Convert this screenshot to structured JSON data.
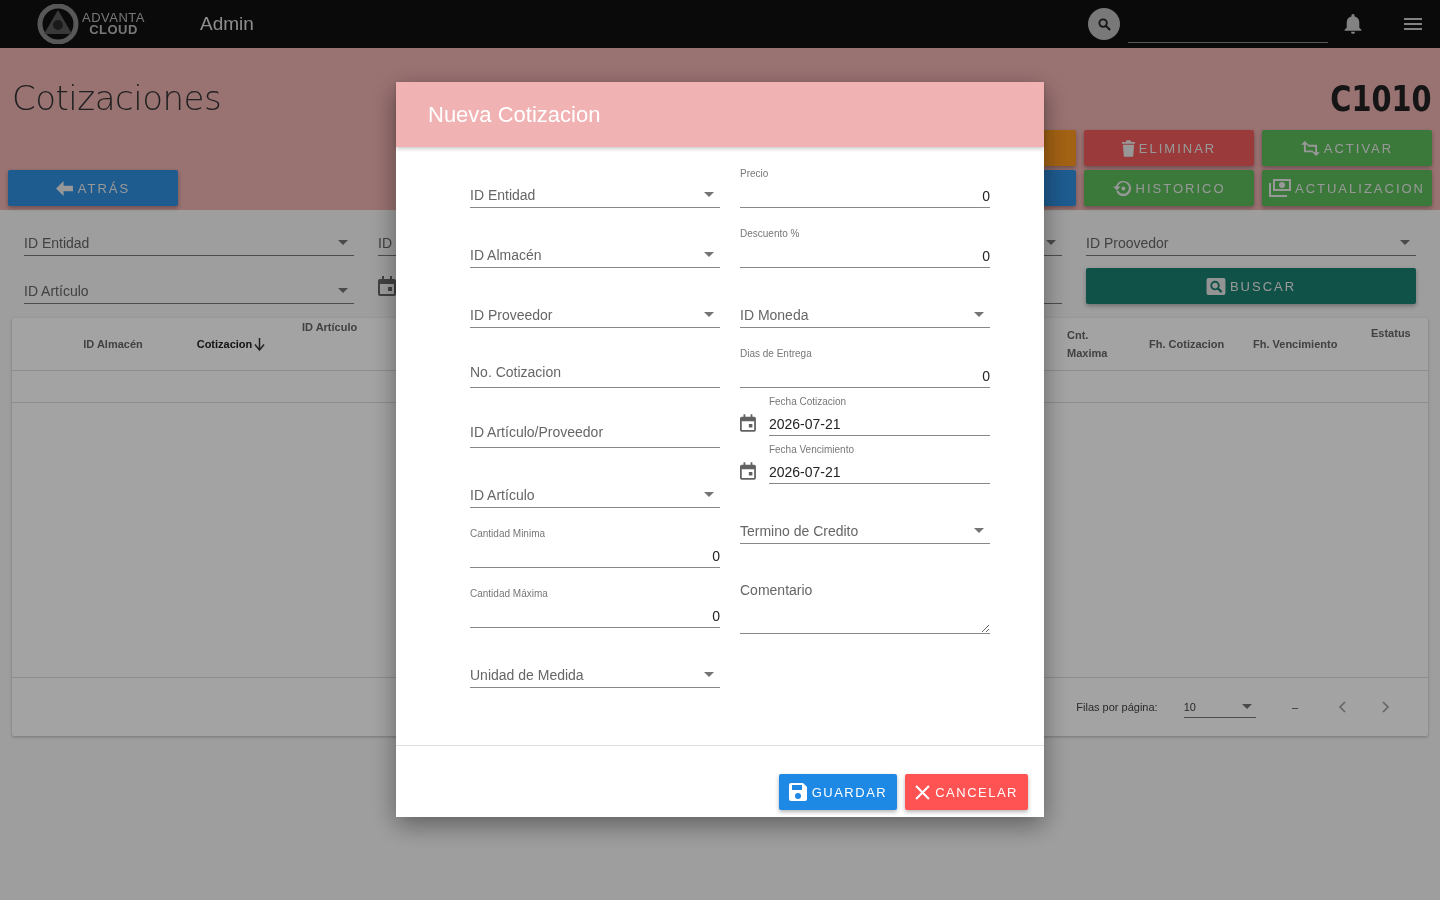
{
  "top_bar": {
    "logo": {
      "line1": "ADVANTA",
      "line2": "CLOUD"
    },
    "title": "Admin"
  },
  "page": {
    "title": "Cotizaciones",
    "code": "C1010",
    "back_button": "ATRÁS",
    "actions": [
      {
        "kind": "warning"
      },
      {
        "kind": "delete",
        "label": "ELIMINAR"
      },
      {
        "kind": "activate",
        "label": "ACTIVAR"
      },
      {
        "kind": "info"
      },
      {
        "kind": "history",
        "label": "HISTORICO"
      },
      {
        "kind": "update",
        "label": "ACTUALIZACION"
      }
    ]
  },
  "filters": {
    "left": [
      {
        "kind": "select",
        "label": "ID Entidad"
      },
      {
        "kind": "select",
        "label": "ID Artículo"
      }
    ],
    "middle": [
      {
        "kind": "select",
        "label": "ID"
      },
      {
        "kind": "date"
      }
    ],
    "right": [
      {
        "kind": "select",
        "label": "ID Proovedor"
      },
      {
        "kind": "button",
        "label": "BUSCAR"
      }
    ]
  },
  "table": {
    "columns_left": [
      {
        "label": "ID Almacén",
        "sorted": false
      },
      {
        "label": "Cotizacion",
        "sorted": true
      },
      {
        "label": "ID Artículo",
        "sorted": false
      }
    ],
    "columns_right": [
      {
        "label": "Cnt. Maxima",
        "sorted": false
      },
      {
        "label": "Fh. Cotizacion",
        "sorted": false
      },
      {
        "label": "Fh. Vencimiento",
        "sorted": false
      },
      {
        "label": "Estatus",
        "sorted": false
      }
    ],
    "pagination": {
      "rows_label": "Filas por página:",
      "rows_per_page": "10",
      "range": "–"
    }
  },
  "dialog": {
    "title": "Nueva Cotizacion",
    "left_fields": [
      {
        "kind": "select",
        "label": "ID Entidad"
      },
      {
        "kind": "select",
        "label": "ID Almacén"
      },
      {
        "kind": "select",
        "label": "ID Proveedor"
      },
      {
        "kind": "text",
        "placeholder": "No. Cotizacion"
      },
      {
        "kind": "text",
        "placeholder": "ID Artículo/Proveedor"
      },
      {
        "kind": "select",
        "label": "ID Artículo"
      },
      {
        "kind": "number",
        "label": "Cantidad Minima",
        "value": "0"
      },
      {
        "kind": "number",
        "label": "Cantidad Máxima",
        "value": "0"
      },
      {
        "kind": "select",
        "label": "Unidad de Medida"
      }
    ],
    "right_fields": [
      {
        "kind": "number",
        "label": "Precio",
        "value": "0"
      },
      {
        "kind": "number",
        "label": "Descuento %",
        "value": "0"
      },
      {
        "kind": "select",
        "label": "ID Moneda"
      },
      {
        "kind": "number",
        "label": "Dias de Entrega",
        "value": "0"
      },
      {
        "kind": "date",
        "label": "Fecha Cotizacion",
        "value": "2026-07-21"
      },
      {
        "kind": "date",
        "label": "Fecha Vencimiento",
        "value": "2026-07-21"
      },
      {
        "kind": "select",
        "label": "Termino de Credito"
      },
      {
        "kind": "textarea",
        "placeholder": "Comentario"
      }
    ],
    "buttons": [
      {
        "kind": "save",
        "label": "GUARDAR"
      },
      {
        "kind": "cancel",
        "label": "CANCELAR"
      }
    ]
  }
}
